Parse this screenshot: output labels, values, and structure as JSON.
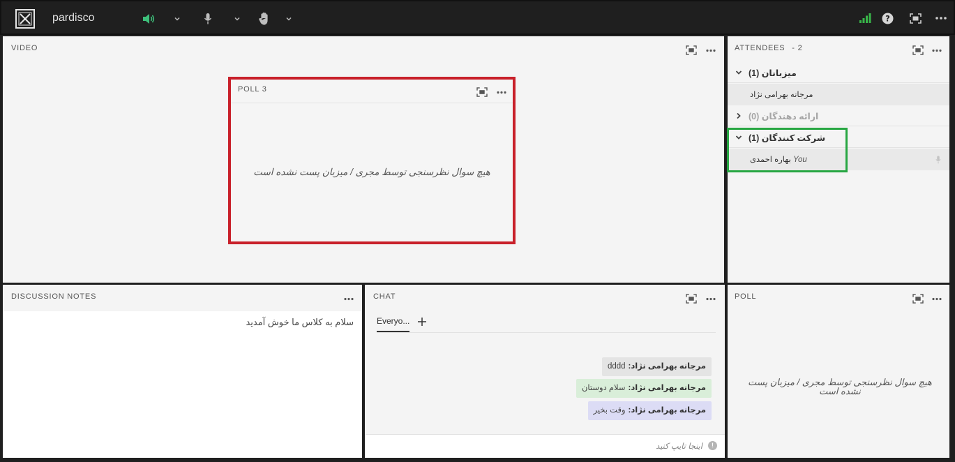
{
  "app": {
    "title": "pardisco"
  },
  "panels": {
    "video": {
      "title": "VIDEO"
    },
    "poll_overlay": {
      "title": "POLL 3",
      "empty_message": "هیچ سوال نظرسنجی توسط مجری / میزبان پست نشده است"
    },
    "attendees": {
      "title": "ATTENDEES",
      "count": "- 2",
      "groups": [
        {
          "label": "میزبانان (1)",
          "expanded": true,
          "members": [
            {
              "name": "مرجانه بهرامی نژاد"
            }
          ]
        },
        {
          "label": "ارائه دهندگان (0)",
          "expanded": false,
          "members": []
        },
        {
          "label": "شرکت کنندگان (1)",
          "expanded": true,
          "members": [
            {
              "name": "بهاره احمدی",
              "you_tag": "You"
            }
          ]
        }
      ]
    },
    "notes": {
      "title": "DISCUSSION NOTES",
      "content": "سلام به کلاس ما خوش آمدید"
    },
    "chat": {
      "title": "CHAT",
      "active_tab": "Everyo...",
      "messages": [
        {
          "sender": "مرجانه بهرامی نژاد:",
          "text": "dddd",
          "color": "#e4e4e4"
        },
        {
          "sender": "مرجانه بهرامی نژاد:",
          "text": "سلام دوستان",
          "color": "#d9eed9"
        },
        {
          "sender": "مرجانه بهرامی نژاد:",
          "text": "وقت بخیر",
          "color": "#dcdcf5"
        }
      ],
      "input_placeholder": "اینجا تایپ کنید"
    },
    "poll": {
      "title": "POLL",
      "empty_message": "هیچ سوال نظرسنجی توسط مجری / میزبان پست نشده است"
    }
  },
  "colors": {
    "topbar_bg": "#1f1f1f",
    "panel_bg": "#f4f4f4",
    "speaker_accent": "#3dbf7a",
    "signal_accent": "#38b549",
    "overlay_red": "#c8202a",
    "overlay_green": "#27a642"
  },
  "icons": {
    "speaker": "speaker-icon",
    "mic": "microphone-icon",
    "hand": "raise-hand-icon",
    "signal": "signal-bars-icon",
    "help": "help-icon",
    "fullscreen": "fullscreen-icon",
    "more": "more-icon"
  }
}
